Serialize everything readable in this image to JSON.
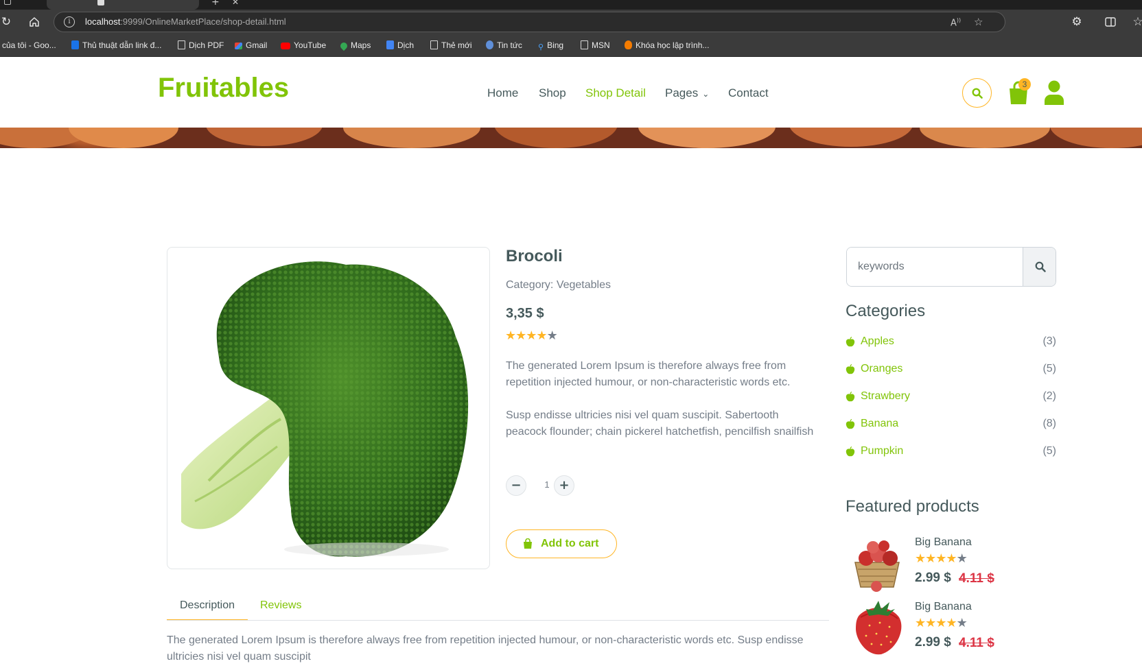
{
  "browser": {
    "url_host": "localhost",
    "url_rest": ":9999/OnlineMarketPlace/shop-detail.html",
    "bookmarks": [
      {
        "label": "của tôi - Goo...",
        "icon": "google-doc-icon"
      },
      {
        "label": "Thủ thuật dẫn link đ...",
        "icon": "blue-flag-icon"
      },
      {
        "label": "Dịch PDF",
        "icon": "document-icon"
      },
      {
        "label": "Gmail",
        "icon": "gmail-icon"
      },
      {
        "label": "YouTube",
        "icon": "youtube-icon"
      },
      {
        "label": "Maps",
        "icon": "maps-pin-icon"
      },
      {
        "label": "Dịch",
        "icon": "translate-icon"
      },
      {
        "label": "Thẻ mới",
        "icon": "document-icon"
      },
      {
        "label": "Tin tức",
        "icon": "news-icon"
      },
      {
        "label": "Bing",
        "icon": "search-icon"
      },
      {
        "label": "MSN",
        "icon": "document-icon"
      },
      {
        "label": "Khóa học lập trình...",
        "icon": "flame-icon"
      }
    ]
  },
  "header": {
    "brand": "Fruitables",
    "nav": [
      "Home",
      "Shop",
      "Shop Detail",
      "Pages",
      "Contact"
    ],
    "active_nav": "Shop Detail",
    "cart_count": "3"
  },
  "product": {
    "name": "Brocoli",
    "category": "Category: Vegetables",
    "price": "3,35 $",
    "rating": 4,
    "rating_max": 5,
    "description_1": "The generated Lorem Ipsum is therefore always free from repetition injected humour, or non-characteristic words etc.",
    "description_2": "Susp endisse ultricies nisi vel quam suscipit. Sabertooth peacock flounder; chain pickerel hatchetfish, pencilfish snailfish",
    "quantity": "1",
    "add_to_cart": "Add to cart",
    "image": "broccoli-photo"
  },
  "tabs": {
    "description": "Description",
    "reviews": "Reviews",
    "content": "The generated Lorem Ipsum is therefore always free from repetition injected humour, or non-characteristic words etc. Susp endisse ultricies nisi vel quam suscipit"
  },
  "sidebar": {
    "search_placeholder": "keywords",
    "categories_title": "Categories",
    "categories": [
      {
        "name": "Apples",
        "count": "(3)"
      },
      {
        "name": "Oranges",
        "count": "(5)"
      },
      {
        "name": "Strawbery",
        "count": "(2)"
      },
      {
        "name": "Banana",
        "count": "(8)"
      },
      {
        "name": "Pumpkin",
        "count": "(5)"
      }
    ],
    "featured_title": "Featured products",
    "featured": [
      {
        "name": "Big Banana",
        "price": "2.99 $",
        "old_price": "4.11 $",
        "rating": 4,
        "image": "apple-basket-photo"
      },
      {
        "name": "Big Banana",
        "price": "2.99 $",
        "old_price": "4.11 $",
        "rating": 4,
        "image": "strawberry-photo"
      }
    ]
  },
  "colors": {
    "primary": "#81c408",
    "secondary": "#ffb524",
    "dark": "#45595b",
    "muted": "#747d88",
    "danger": "#dc3545"
  }
}
